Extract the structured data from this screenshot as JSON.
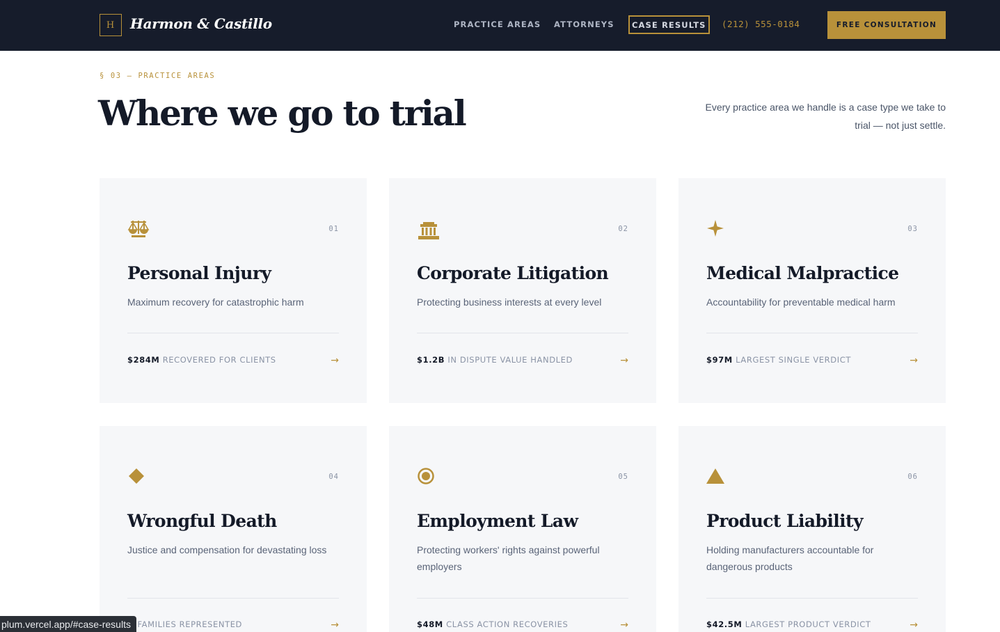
{
  "nav": {
    "logo_mark": "H",
    "brand": "Harmon & Castillo",
    "links": [
      "PRACTICE AREAS",
      "ATTORNEYS",
      "CASE RESULTS"
    ],
    "active_link": "CASE RESULTS",
    "phone": "(212) 555-0184",
    "cta": "FREE CONSULTATION"
  },
  "section": {
    "eyebrow": "§ 03 — PRACTICE AREAS",
    "title": "Where we go to trial",
    "intro": "Every practice area we handle is a case type we take to trial — not just settle."
  },
  "cards": [
    {
      "number": "01",
      "icon": "scales-icon",
      "title": "Personal Injury",
      "description": "Maximum recovery for catastrophic harm",
      "stat_value": "$284M",
      "stat_label": "RECOVERED FOR CLIENTS",
      "arrow": "→"
    },
    {
      "number": "02",
      "icon": "courthouse-icon",
      "title": "Corporate Litigation",
      "description": "Protecting business interests at every level",
      "stat_value": "$1.2B",
      "stat_label": "IN DISPUTE VALUE HANDLED",
      "arrow": "→"
    },
    {
      "number": "03",
      "icon": "sparkle-icon",
      "title": "Medical Malpractice",
      "description": "Accountability for preventable medical harm",
      "stat_value": "$97M",
      "stat_label": "LARGEST SINGLE VERDICT",
      "arrow": "→"
    },
    {
      "number": "04",
      "icon": "diamond-icon",
      "title": "Wrongful Death",
      "description": "Justice and compensation for devastating loss",
      "stat_value": "",
      "stat_label": "+ FAMILIES REPRESENTED",
      "arrow": "→"
    },
    {
      "number": "05",
      "icon": "target-icon",
      "title": "Employment Law",
      "description": "Protecting workers' rights against powerful employers",
      "stat_value": "$48M",
      "stat_label": "CLASS ACTION RECOVERIES",
      "arrow": "→"
    },
    {
      "number": "06",
      "icon": "triangle-icon",
      "title": "Product Liability",
      "description": "Holding manufacturers accountable for dangerous products",
      "stat_value": "$42.5M",
      "stat_label": "LARGEST PRODUCT VERDICT",
      "arrow": "→"
    }
  ],
  "status_bar": {
    "url": "plum.vercel.app/#case-results"
  },
  "colors": {
    "navy": "#161c2b",
    "gold": "#b8913a",
    "card_bg": "#f6f7f9"
  }
}
